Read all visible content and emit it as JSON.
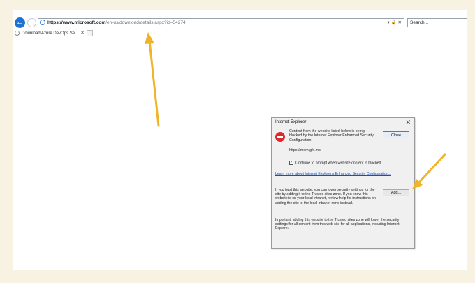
{
  "browser": {
    "url_bold": "https://www.microsoft.com",
    "url_rest": "/en-us/download/details.aspx?id=54274",
    "addr_controls": "▾ 🔒 ✕",
    "search_placeholder": "Search...",
    "tab_title": "Download Azure DevOps Se...",
    "tab_close": "✕"
  },
  "dialog": {
    "title": "Internet Explorer",
    "close_x": "✕",
    "message": "Content from the website listed below is being blocked by the Internet Explorer Enhanced Security Configuration.",
    "close_label": "Close",
    "site": "https://mem.gfx.ms",
    "checkbox_checked": true,
    "checkbox_label": "Continue to prompt when website content is blocked",
    "learn_more": "Learn more about Internet Explorer's Enhanced Security Configuration...",
    "trust_text": "If you trust this website, you can lower security settings for the site by adding it to the Trusted sites zone. If you know this website is on your local intranet, review help for instructions on adding the site to the local intranet zone instead.",
    "add_label": "Add...",
    "important_text": "Important: adding this website to the Trusted sites zone will lower the security settings for all content from this web site for all applications, including Internet Explorer."
  },
  "colors": {
    "annotation_arrow": "#f0b428",
    "background": "#f7f2e2",
    "blocked_icon": "#e0262e",
    "link": "#1b4fb3"
  }
}
